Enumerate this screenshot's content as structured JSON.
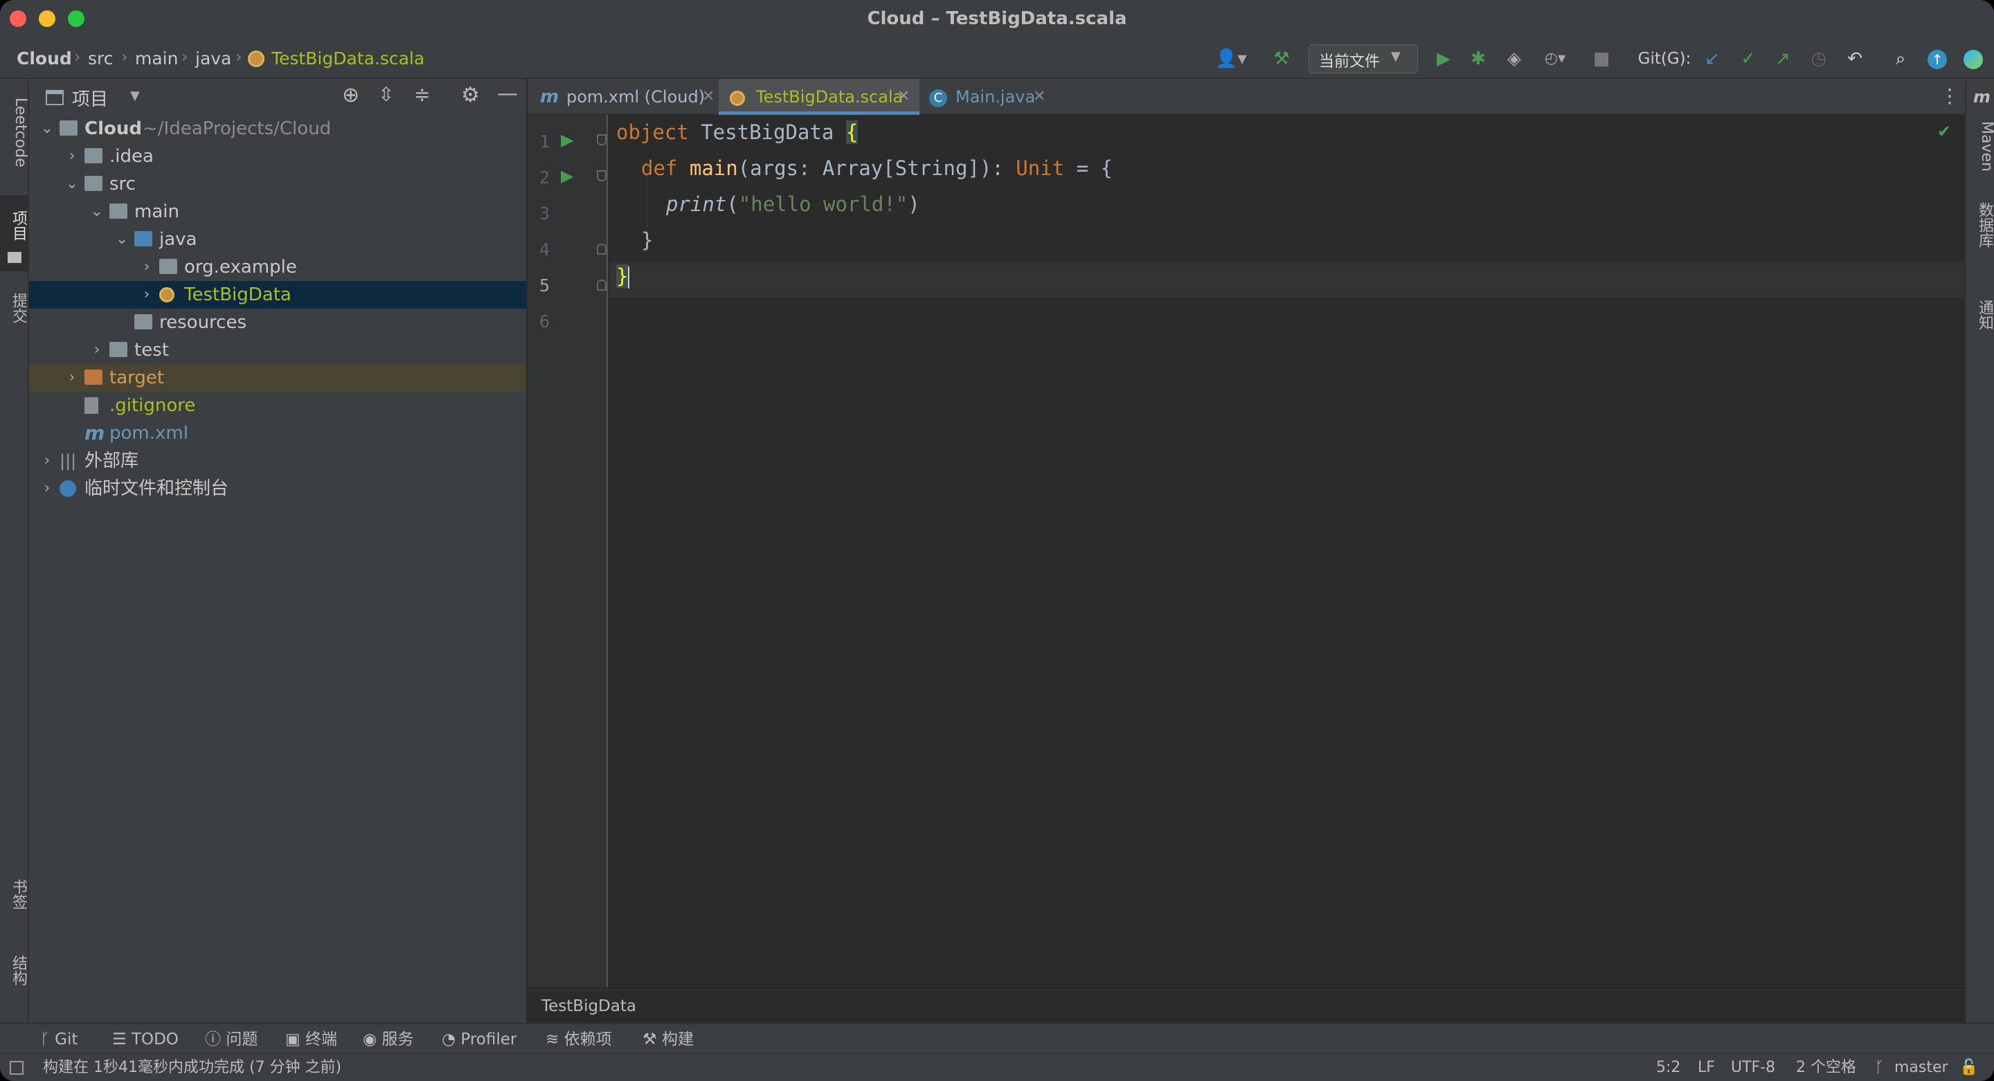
{
  "window": {
    "title": "Cloud – TestBigData.scala"
  },
  "breadcrumb": [
    "Cloud",
    "src",
    "main",
    "java",
    "TestBigData.scala"
  ],
  "toolbar": {
    "run_config": "当前文件",
    "git_label": "Git(G):"
  },
  "left_strip": {
    "leetcode": "Leetcode",
    "project": "项目",
    "commit": "提交",
    "bookmarks": "书签",
    "structure": "结构"
  },
  "right_strip": {
    "maven": "Maven",
    "database": "数据库",
    "notifications": "通知"
  },
  "project": {
    "header": "项目",
    "tree": [
      {
        "label": "Cloud",
        "suffix": "~/IdeaProjects/Cloud",
        "depth": 0,
        "expanded": true,
        "icon": "module-folder-icon",
        "bold": true
      },
      {
        "label": ".idea",
        "depth": 1,
        "expanded": false,
        "icon": "folder-icon"
      },
      {
        "label": "src",
        "depth": 1,
        "expanded": true,
        "icon": "folder-icon"
      },
      {
        "label": "main",
        "depth": 2,
        "expanded": true,
        "icon": "folder-icon"
      },
      {
        "label": "java",
        "depth": 3,
        "expanded": true,
        "icon": "source-folder-icon"
      },
      {
        "label": "org.example",
        "depth": 4,
        "expanded": false,
        "icon": "package-icon"
      },
      {
        "label": "TestBigData",
        "depth": 4,
        "expanded": false,
        "icon": "scala-object-icon",
        "selected": true,
        "color": "#a8c023"
      },
      {
        "label": "resources",
        "depth": 3,
        "icon": "resources-folder-icon"
      },
      {
        "label": "test",
        "depth": 2,
        "expanded": false,
        "icon": "folder-icon"
      },
      {
        "label": "target",
        "depth": 1,
        "expanded": false,
        "icon": "excluded-folder-icon",
        "highlighted": true,
        "color": "#d19a56"
      },
      {
        "label": ".gitignore",
        "depth": 1,
        "icon": "gitignore-file-icon",
        "color": "#a8c023"
      },
      {
        "label": "pom.xml",
        "depth": 1,
        "icon": "maven-file-icon",
        "color": "#6897bb"
      },
      {
        "label": "外部库",
        "depth": 0,
        "expanded": false,
        "icon": "library-icon"
      },
      {
        "label": "临时文件和控制台",
        "depth": 0,
        "expanded": false,
        "icon": "scratch-icon"
      }
    ]
  },
  "tabs": [
    {
      "label": "pom.xml (Cloud)",
      "icon": "maven-file-icon",
      "active": false
    },
    {
      "label": "TestBigData.scala",
      "icon": "scala-object-icon",
      "active": true
    },
    {
      "label": "Main.java",
      "icon": "java-class-icon",
      "active": false
    }
  ],
  "code_lines": [
    "1",
    "2",
    "3",
    "4",
    "5",
    "6"
  ],
  "code": {
    "line1_kw": "object",
    "line1_name": " TestBigData ",
    "line1_brace": "{",
    "line2_kw": "def",
    "line2_fn": "main",
    "line2_rest": "(args: Array[String]): ",
    "line2_type": "Unit",
    "line2_tail": " = {",
    "line3_fn": "print",
    "line3_open": "(",
    "line3_str": "\"hello world!\"",
    "line3_close": ")",
    "line4": "}",
    "line5": "}"
  },
  "editor_breadcrumb": "TestBigData",
  "bottom_tools": [
    "Git",
    "TODO",
    "问题",
    "终端",
    "服务",
    "Profiler",
    "依赖项",
    "构建"
  ],
  "status": {
    "message": "构建在 1秒41毫秒内成功完成 (7 分钟 之前)",
    "position": "5:2",
    "line_separator": "LF",
    "encoding": "UTF-8",
    "indent": "2 个空格",
    "branch": "master"
  },
  "colors": {
    "accent": "#4a88c7",
    "run_green": "#499c54",
    "selection": "#0d293e",
    "excluded": "#d19a56"
  }
}
